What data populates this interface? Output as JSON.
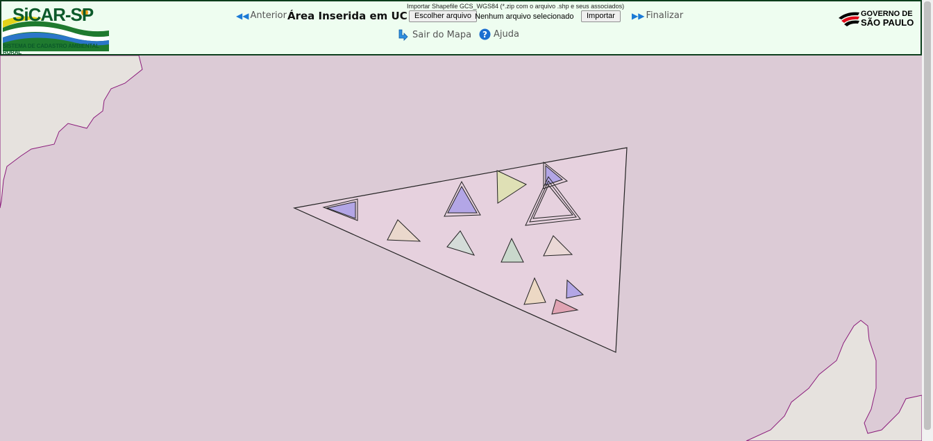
{
  "header": {
    "logo_title": "SiCAR-SP",
    "logo_subtitle": "SISTEMA DE CADASTRO AMBIENTAL RURAL",
    "import_hint": "Importar Shapefile GCS_WGS84 (*.zip com o arquivo .shp e seus associados)",
    "prev_label": "Anterior",
    "page_title": "Área Inserida em UC",
    "choose_file_label": "Escolher arquivo",
    "file_status": "Nenhum arquivo selecionado",
    "import_label": "Importar",
    "finish_label": "Finalizar",
    "exit_map_label": "Sair do Mapa",
    "help_label": "Ajuda",
    "gov_line1": "GOVERNO DE",
    "gov_line2": "SÃO PAULO"
  },
  "icons": {
    "prev": "double-left-arrow-icon",
    "finish": "double-right-arrow-icon",
    "exit": "down-arrow-icon",
    "help": "question-icon"
  },
  "colors": {
    "header_bg": "#eefdf0",
    "header_border": "#0b3d1b",
    "map_region": "#dccbd6",
    "map_outside": "#e6e2de",
    "boundary": "#8a1a7a"
  }
}
